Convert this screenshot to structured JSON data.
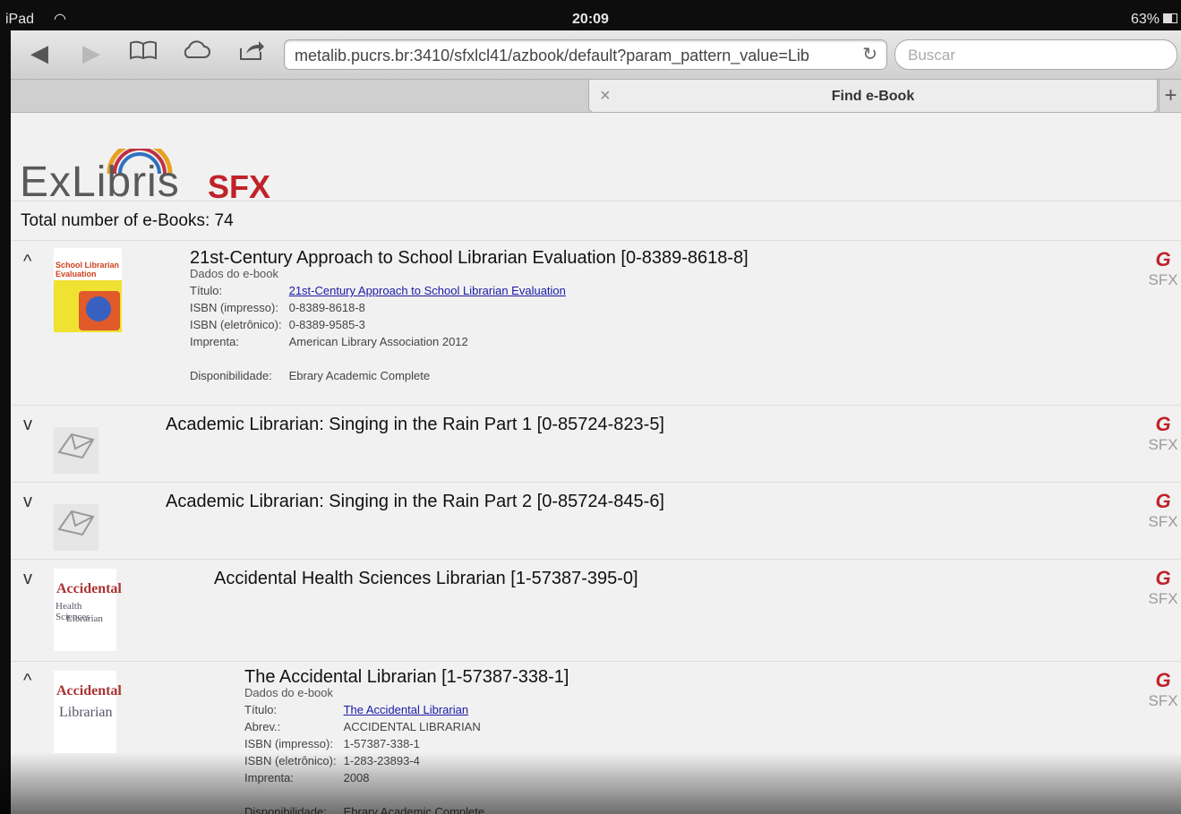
{
  "status_bar": {
    "carrier": "iPad",
    "time": "20:09",
    "battery": "63%"
  },
  "browser": {
    "url": "metalib.pucrs.br:3410/sfxlcl41/azbook/default?param_pattern_value=Lib",
    "search_placeholder": "Buscar",
    "tab_title": "Find e-Book",
    "tab_close": "×",
    "new_tab": "+"
  },
  "logo": {
    "exlibris": "ExLibris",
    "sfx": "SFX"
  },
  "total_label": "Total number of e-Books: 74",
  "sfx_badge": {
    "symbol": "G",
    "text": "SFX"
  },
  "items": [
    {
      "expanded": "^",
      "title": "21st-Century Approach to School Librarian Evaluation [0-8389-8618-8]",
      "details_header": "Dados do e-book",
      "fields": [
        {
          "k": "Título:",
          "v": "21st-Century Approach to School Librarian Evaluation"
        },
        {
          "k": "ISBN (impresso):",
          "v": "0-8389-8618-8"
        },
        {
          "k": "ISBN (eletrônico):",
          "v": "0-8389-9585-3"
        },
        {
          "k": "Imprenta:",
          "v": "American Library Association 2012"
        },
        {
          "k": "Disponibilidade:",
          "v": "Ebrary Academic Complete"
        }
      ]
    },
    {
      "expanded": "v",
      "title": "Academic Librarian: Singing in the Rain Part 1 [0-85724-823-5]"
    },
    {
      "expanded": "v",
      "title": "Academic Librarian: Singing in the Rain Part 2 [0-85724-845-6]"
    },
    {
      "expanded": "v",
      "title": "Accidental Health Sciences Librarian [1-57387-395-0]"
    },
    {
      "expanded": "^",
      "title": "The Accidental Librarian [1-57387-338-1]",
      "details_header": "Dados do e-book",
      "fields": [
        {
          "k": "Título:",
          "v": "The Accidental Librarian"
        },
        {
          "k": "Abrev.:",
          "v": "ACCIDENTAL LIBRARIAN"
        },
        {
          "k": "ISBN (impresso):",
          "v": "1-57387-338-1"
        },
        {
          "k": "ISBN (eletrônico):",
          "v": "1-283-23893-4"
        },
        {
          "k": "Imprenta:",
          "v": "2008"
        },
        {
          "k": "Disponibilidade:",
          "v": "Ebrary Academic Complete"
        }
      ]
    }
  ],
  "covers": {
    "book1": {
      "band": "School Librarian Evaluation"
    },
    "health": {
      "t1": "Accidental",
      "t2": "Health Sciences",
      "t3": "Librarian"
    },
    "accidental": {
      "t1": "Accidental",
      "t2": "Librarian"
    }
  }
}
